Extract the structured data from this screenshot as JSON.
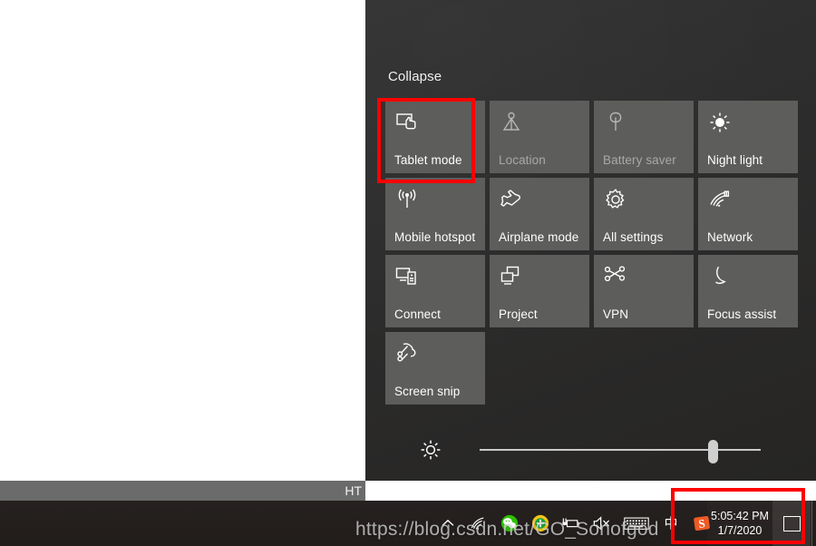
{
  "window": {
    "statusbar_text": "HT"
  },
  "action_center": {
    "collapse_label": "Collapse",
    "tiles": [
      [
        {
          "label": "Tablet mode",
          "icon": "tablet-mode-icon",
          "state": "on"
        },
        {
          "label": "Location",
          "icon": "location-icon",
          "state": "dim"
        },
        {
          "label": "Battery saver",
          "icon": "battery-saver-icon",
          "state": "dim"
        },
        {
          "label": "Night light",
          "icon": "night-light-icon",
          "state": "on"
        }
      ],
      [
        {
          "label": "Mobile hotspot",
          "icon": "mobile-hotspot-icon",
          "state": "on"
        },
        {
          "label": "Airplane mode",
          "icon": "airplane-icon",
          "state": "on"
        },
        {
          "label": "All settings",
          "icon": "gear-icon",
          "state": "on"
        },
        {
          "label": "Network",
          "icon": "network-icon",
          "state": "on"
        }
      ],
      [
        {
          "label": "Connect",
          "icon": "connect-icon",
          "state": "on"
        },
        {
          "label": "Project",
          "icon": "project-icon",
          "state": "on"
        },
        {
          "label": "VPN",
          "icon": "vpn-icon",
          "state": "on"
        },
        {
          "label": "Focus assist",
          "icon": "moon-icon",
          "state": "on"
        }
      ],
      [
        {
          "label": "Screen snip",
          "icon": "screen-snip-icon",
          "state": "on"
        },
        {
          "label": "",
          "icon": "",
          "state": "empty"
        },
        {
          "label": "",
          "icon": "",
          "state": "empty"
        },
        {
          "label": "",
          "icon": "",
          "state": "empty"
        }
      ]
    ],
    "brightness": {
      "icon": "brightness-icon",
      "value_percent": 83
    }
  },
  "taskbar": {
    "tray_icons": [
      {
        "name": "show-hidden-icons-chevron-icon"
      },
      {
        "name": "wifi-icon"
      },
      {
        "name": "wechat-icon"
      },
      {
        "name": "360-security-icon"
      },
      {
        "name": "battery-charging-icon"
      },
      {
        "name": "volume-muted-icon"
      },
      {
        "name": "touch-keyboard-icon"
      },
      {
        "name": "ime-mode-icon"
      },
      {
        "name": "sogou-input-icon"
      }
    ],
    "ime_char": "中",
    "clock": {
      "time": "5:05:42 PM",
      "date": "1/7/2020"
    },
    "action_center_button_name": "action-center-button"
  },
  "annotations": {
    "highlight_color": "#fe0000",
    "boxes": [
      {
        "name": "tablet-mode-highlight"
      },
      {
        "name": "clock-action-center-highlight"
      }
    ]
  },
  "watermark": {
    "text": "https://blog.csdn.net/GO_Sonofgod"
  }
}
